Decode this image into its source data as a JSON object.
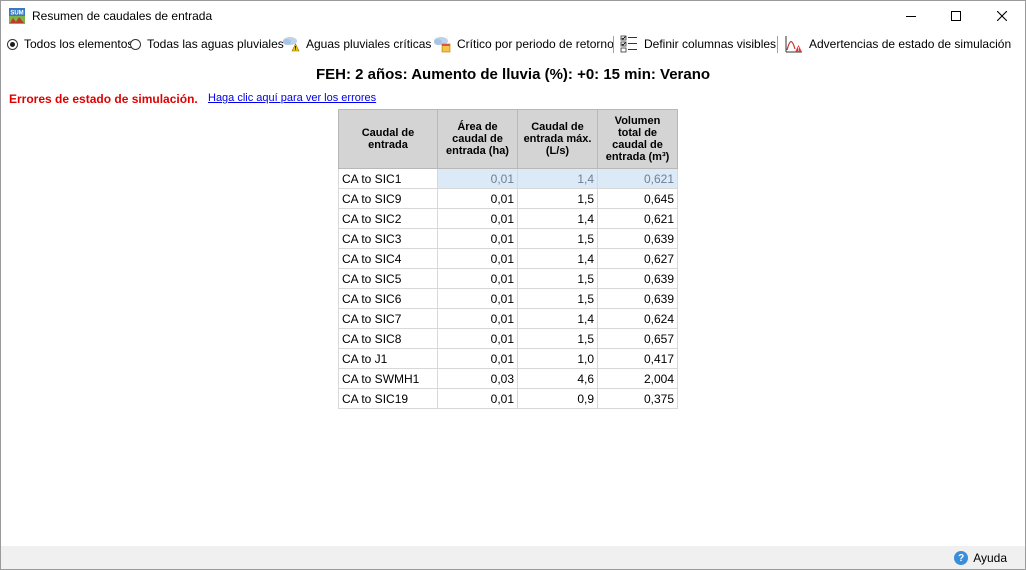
{
  "window": {
    "title": "Resumen de caudales de entrada",
    "app_icon_text": "SUM"
  },
  "toolbar": {
    "radio_all_elements": "Todos los elementos",
    "radio_all_rainwater": "Todas las aguas pluviales",
    "critical_rainwater": "Aguas pluviales críticas",
    "critical_by_return_period": "Crítico por periodo de retorno",
    "define_visible_columns": "Definir columnas visibles",
    "simulation_status_warnings": "Advertencias de estado de simulación"
  },
  "headline": "FEH: 2 años: Aumento de lluvia (%): +0: 15 min: Verano",
  "errors": {
    "label": "Errores de estado de simulación.",
    "link": "Haga clic aquí para ver los errores",
    "color": "#e00000"
  },
  "table": {
    "headers": [
      "Caudal de entrada",
      "Área de caudal de entrada (ha)",
      "Caudal de entrada máx. (L/s)",
      "Volumen total de caudal de entrada (m³)"
    ],
    "rows": [
      [
        "CA to SIC1",
        "0,01",
        "1,4",
        "0,621"
      ],
      [
        "CA to SIC9",
        "0,01",
        "1,5",
        "0,645"
      ],
      [
        "CA to SIC2",
        "0,01",
        "1,4",
        "0,621"
      ],
      [
        "CA to SIC3",
        "0,01",
        "1,5",
        "0,639"
      ],
      [
        "CA to SIC4",
        "0,01",
        "1,4",
        "0,627"
      ],
      [
        "CA to SIC5",
        "0,01",
        "1,5",
        "0,639"
      ],
      [
        "CA to SIC6",
        "0,01",
        "1,5",
        "0,639"
      ],
      [
        "CA to SIC7",
        "0,01",
        "1,4",
        "0,624"
      ],
      [
        "CA to SIC8",
        "0,01",
        "1,5",
        "0,657"
      ],
      [
        "CA to J1",
        "0,01",
        "1,0",
        "0,417"
      ],
      [
        "CA to SWMH1",
        "0,03",
        "4,6",
        "2,004"
      ],
      [
        "CA to SIC19",
        "0,01",
        "0,9",
        "0,375"
      ]
    ],
    "selected_row": 0
  },
  "footer": {
    "help_label": "Ayuda"
  }
}
